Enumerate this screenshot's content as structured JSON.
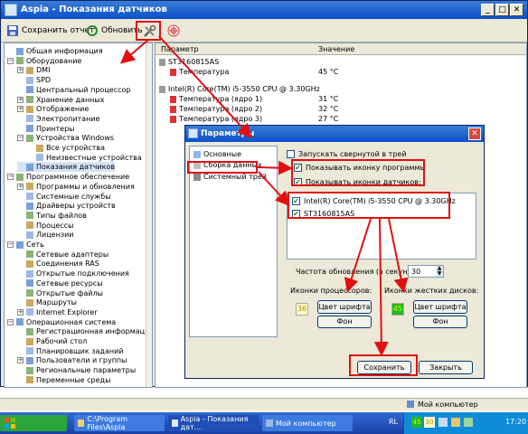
{
  "window": {
    "title": "Aspia - Показания датчиков"
  },
  "toolbar": {
    "save_report": "Сохранить отчет",
    "refresh": "Обновить"
  },
  "tree": [
    {
      "label": "Общая информация",
      "level": 0,
      "expander": ""
    },
    {
      "label": "Оборудование",
      "level": 0,
      "expander": "−"
    },
    {
      "label": "DMI",
      "level": 1,
      "expander": "+"
    },
    {
      "label": "SPD",
      "level": 1,
      "expander": ""
    },
    {
      "label": "Центральный процессор",
      "level": 1,
      "expander": ""
    },
    {
      "label": "Хранение данных",
      "level": 1,
      "expander": "+"
    },
    {
      "label": "Отображение",
      "level": 1,
      "expander": "+"
    },
    {
      "label": "Электропитание",
      "level": 1,
      "expander": ""
    },
    {
      "label": "Принтеры",
      "level": 1,
      "expander": ""
    },
    {
      "label": "Устройства Windows",
      "level": 1,
      "expander": "−"
    },
    {
      "label": "Все устройства",
      "level": 2,
      "expander": ""
    },
    {
      "label": "Неизвестные устройства",
      "level": 2,
      "expander": ""
    },
    {
      "label": "Показания датчиков",
      "level": 1,
      "expander": ""
    },
    {
      "label": "Программное обеспечение",
      "level": 0,
      "expander": "−"
    },
    {
      "label": "Программы и обновления",
      "level": 1,
      "expander": "+"
    },
    {
      "label": "Системные службы",
      "level": 1,
      "expander": ""
    },
    {
      "label": "Драйверы устройств",
      "level": 1,
      "expander": ""
    },
    {
      "label": "Типы файлов",
      "level": 1,
      "expander": ""
    },
    {
      "label": "Процессы",
      "level": 1,
      "expander": ""
    },
    {
      "label": "Лицензии",
      "level": 1,
      "expander": ""
    },
    {
      "label": "Сеть",
      "level": 0,
      "expander": "−"
    },
    {
      "label": "Сетевые адаптеры",
      "level": 1,
      "expander": ""
    },
    {
      "label": "Соединения RAS",
      "level": 1,
      "expander": ""
    },
    {
      "label": "Открытые подключения",
      "level": 1,
      "expander": ""
    },
    {
      "label": "Сетевые ресурсы",
      "level": 1,
      "expander": ""
    },
    {
      "label": "Открытые файлы",
      "level": 1,
      "expander": ""
    },
    {
      "label": "Маршруты",
      "level": 1,
      "expander": ""
    },
    {
      "label": "Internet Explorer",
      "level": 1,
      "expander": "+"
    },
    {
      "label": "Операционная система",
      "level": 0,
      "expander": "−"
    },
    {
      "label": "Регистрационная информация",
      "level": 1,
      "expander": ""
    },
    {
      "label": "Рабочий стол",
      "level": 1,
      "expander": ""
    },
    {
      "label": "Планировщик заданий",
      "level": 1,
      "expander": ""
    },
    {
      "label": "Пользователи и группы",
      "level": 1,
      "expander": "+"
    },
    {
      "label": "Региональные параметры",
      "level": 1,
      "expander": ""
    },
    {
      "label": "Переменные среды",
      "level": 1,
      "expander": ""
    }
  ],
  "main": {
    "col_param": "Параметр",
    "col_value": "Значение",
    "rows": [
      {
        "param": "ST3160815AS",
        "value": "",
        "kind": "group"
      },
      {
        "param": "Температура",
        "value": "45 °C",
        "kind": "item"
      },
      {
        "param": "",
        "value": "",
        "kind": "gap"
      },
      {
        "param": "Intel(R) Core(TM) i5-3550 CPU @ 3.30GHz",
        "value": "",
        "kind": "group"
      },
      {
        "param": "Температура (ядро 1)",
        "value": "31 °C",
        "kind": "item"
      },
      {
        "param": "Температура (ядро 2)",
        "value": "32 °C",
        "kind": "item"
      },
      {
        "param": "Температура (ядро 3)",
        "value": "27 °C",
        "kind": "item"
      }
    ]
  },
  "dialog": {
    "title": "Параметры",
    "nav": [
      "Основные",
      "Сборка данных",
      "Системный трей"
    ],
    "start_minimized": "Запускать свернутой в трей",
    "show_app_icon": "Показывать иконку программы",
    "show_sensor_icons": "Показывать иконки датчиков:",
    "sensors": [
      "Intel(R) Core(TM) i5-3550 CPU @ 3.30GHz",
      "ST3160815AS"
    ],
    "refresh_label": "Частота обновления (в секундах):",
    "refresh_value": "30",
    "cpu_icons_label": "Иконки процессоров:",
    "cpu_sample": "36",
    "disk_icons_label": "Иконки жестких дисков:",
    "disk_sample": "45",
    "font_color_btn": "Цвет шрифта",
    "bg_btn": "Фон",
    "save_btn": "Сохранить",
    "close_btn": "Закрыть"
  },
  "statusbar": {
    "text": "Мой компьютер"
  },
  "taskbar": {
    "start": "",
    "items": [
      "C:\\Program Files\\Aspia",
      "Aspia - Показания дат...",
      "Мой компьютер"
    ],
    "lang": "RL",
    "tray_nums": [
      "45",
      "30"
    ],
    "clock": "17:20"
  },
  "colors": {
    "title_blue": "#0a50c8",
    "highlight_red": "#e01010",
    "cpu_sample_bg": "#fffbc8",
    "cpu_sample_fg": "#b08800",
    "disk_sample_bg": "#22b822",
    "disk_sample_fg": "#d0ff00"
  }
}
